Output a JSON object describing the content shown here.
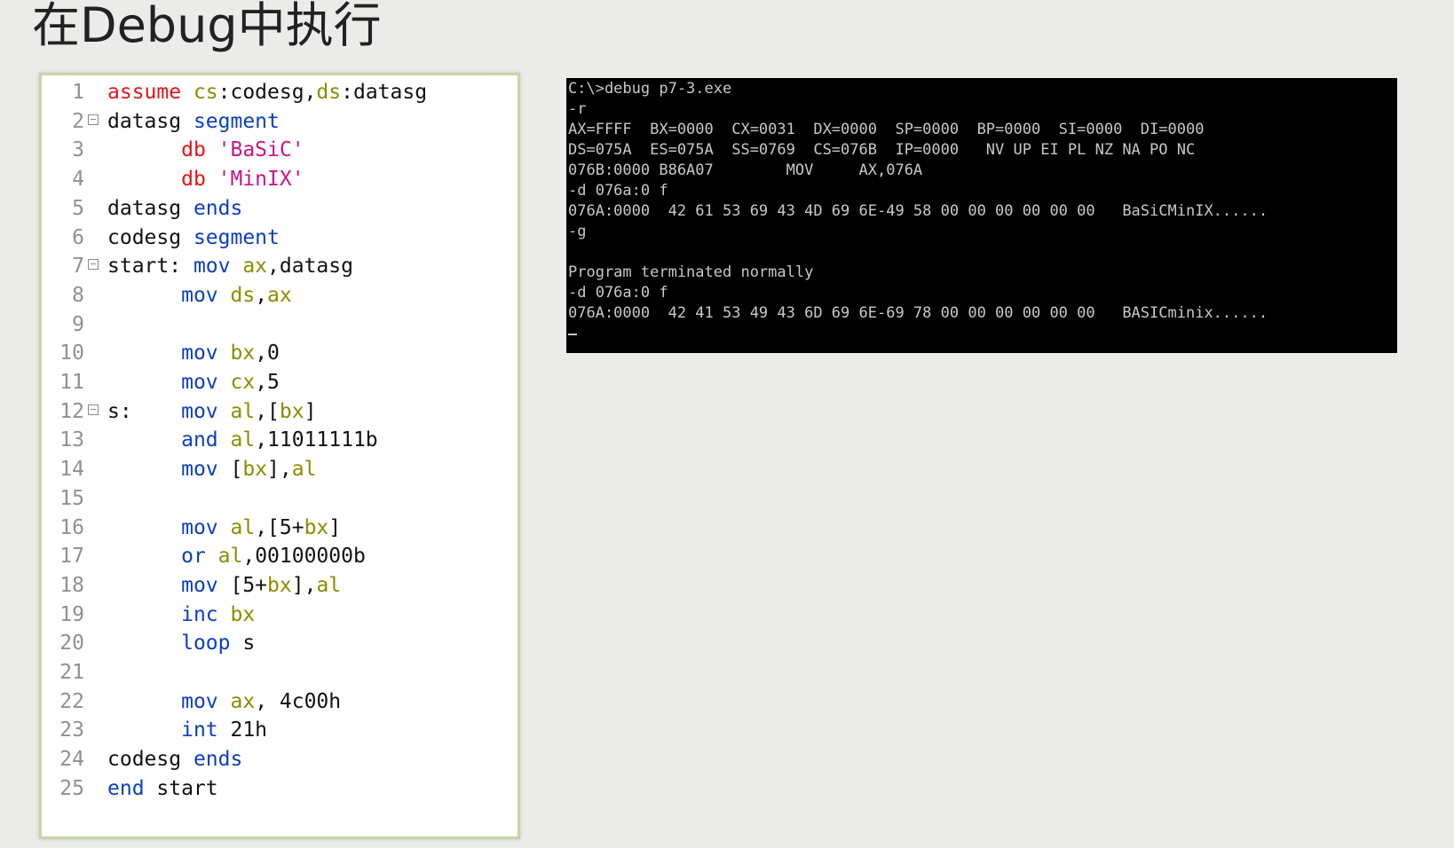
{
  "title": "在Debug中执行",
  "code": {
    "lines": [
      {
        "n": "1",
        "fold": false,
        "tokens": [
          [
            "dir",
            "assume "
          ],
          [
            "reg",
            "cs"
          ],
          [
            "plain",
            ":codesg,"
          ],
          [
            "reg",
            "ds"
          ],
          [
            "plain",
            ":datasg"
          ]
        ]
      },
      {
        "n": "2",
        "fold": true,
        "tokens": [
          [
            "plain",
            "datasg "
          ],
          [
            "kw",
            "segment"
          ]
        ]
      },
      {
        "n": "3",
        "fold": false,
        "tokens": [
          [
            "plain",
            "      "
          ],
          [
            "dir",
            "db "
          ],
          [
            "str",
            "'BaSiC'"
          ]
        ]
      },
      {
        "n": "4",
        "fold": false,
        "tokens": [
          [
            "plain",
            "      "
          ],
          [
            "dir",
            "db "
          ],
          [
            "str",
            "'MinIX'"
          ]
        ]
      },
      {
        "n": "5",
        "fold": false,
        "tokens": [
          [
            "plain",
            "datasg "
          ],
          [
            "kw",
            "ends"
          ]
        ]
      },
      {
        "n": "6",
        "fold": false,
        "tokens": [
          [
            "plain",
            "codesg "
          ],
          [
            "kw",
            "segment"
          ]
        ]
      },
      {
        "n": "7",
        "fold": true,
        "tokens": [
          [
            "plain",
            "start: "
          ],
          [
            "kw",
            "mov "
          ],
          [
            "reg",
            "ax"
          ],
          [
            "plain",
            ",datasg"
          ]
        ]
      },
      {
        "n": "8",
        "fold": false,
        "tokens": [
          [
            "plain",
            "      "
          ],
          [
            "kw",
            "mov "
          ],
          [
            "reg",
            "ds"
          ],
          [
            "plain",
            ","
          ],
          [
            "reg",
            "ax"
          ]
        ]
      },
      {
        "n": "9",
        "fold": false,
        "tokens": []
      },
      {
        "n": "10",
        "fold": false,
        "tokens": [
          [
            "plain",
            "      "
          ],
          [
            "kw",
            "mov "
          ],
          [
            "reg",
            "bx"
          ],
          [
            "plain",
            ",0"
          ]
        ]
      },
      {
        "n": "11",
        "fold": false,
        "tokens": [
          [
            "plain",
            "      "
          ],
          [
            "kw",
            "mov "
          ],
          [
            "reg",
            "cx"
          ],
          [
            "plain",
            ",5"
          ]
        ]
      },
      {
        "n": "12",
        "fold": true,
        "tokens": [
          [
            "plain",
            "s:    "
          ],
          [
            "kw",
            "mov "
          ],
          [
            "reg",
            "al"
          ],
          [
            "plain",
            ",["
          ],
          [
            "reg",
            "bx"
          ],
          [
            "plain",
            "]"
          ]
        ]
      },
      {
        "n": "13",
        "fold": false,
        "tokens": [
          [
            "plain",
            "      "
          ],
          [
            "kw",
            "and "
          ],
          [
            "reg",
            "al"
          ],
          [
            "plain",
            ",11011111b"
          ]
        ]
      },
      {
        "n": "14",
        "fold": false,
        "tokens": [
          [
            "plain",
            "      "
          ],
          [
            "kw",
            "mov "
          ],
          [
            "plain",
            "["
          ],
          [
            "reg",
            "bx"
          ],
          [
            "plain",
            "],"
          ],
          [
            "reg",
            "al"
          ]
        ]
      },
      {
        "n": "15",
        "fold": false,
        "tokens": []
      },
      {
        "n": "16",
        "fold": false,
        "tokens": [
          [
            "plain",
            "      "
          ],
          [
            "kw",
            "mov "
          ],
          [
            "reg",
            "al"
          ],
          [
            "plain",
            ",[5+"
          ],
          [
            "reg",
            "bx"
          ],
          [
            "plain",
            "]"
          ]
        ]
      },
      {
        "n": "17",
        "fold": false,
        "tokens": [
          [
            "plain",
            "      "
          ],
          [
            "kw",
            "or "
          ],
          [
            "reg",
            "al"
          ],
          [
            "plain",
            ",00100000b"
          ]
        ]
      },
      {
        "n": "18",
        "fold": false,
        "tokens": [
          [
            "plain",
            "      "
          ],
          [
            "kw",
            "mov "
          ],
          [
            "plain",
            "[5+"
          ],
          [
            "reg",
            "bx"
          ],
          [
            "plain",
            "],"
          ],
          [
            "reg",
            "al"
          ]
        ]
      },
      {
        "n": "19",
        "fold": false,
        "tokens": [
          [
            "plain",
            "      "
          ],
          [
            "kw",
            "inc "
          ],
          [
            "reg",
            "bx"
          ]
        ]
      },
      {
        "n": "20",
        "fold": false,
        "tokens": [
          [
            "plain",
            "      "
          ],
          [
            "kw",
            "loop "
          ],
          [
            "plain",
            "s"
          ]
        ]
      },
      {
        "n": "21",
        "fold": false,
        "tokens": []
      },
      {
        "n": "22",
        "fold": false,
        "tokens": [
          [
            "plain",
            "      "
          ],
          [
            "kw",
            "mov "
          ],
          [
            "reg",
            "ax"
          ],
          [
            "plain",
            ", 4c00h"
          ]
        ]
      },
      {
        "n": "23",
        "fold": false,
        "tokens": [
          [
            "plain",
            "      "
          ],
          [
            "kw",
            "int "
          ],
          [
            "plain",
            "21h"
          ]
        ]
      },
      {
        "n": "24",
        "fold": false,
        "tokens": [
          [
            "plain",
            "codesg "
          ],
          [
            "kw",
            "ends"
          ]
        ]
      },
      {
        "n": "25",
        "fold": false,
        "tokens": [
          [
            "kw",
            "end "
          ],
          [
            "plain",
            "start"
          ]
        ]
      }
    ]
  },
  "terminal": {
    "lines": [
      "C:\\>debug p7-3.exe",
      "-r",
      "AX=FFFF  BX=0000  CX=0031  DX=0000  SP=0000  BP=0000  SI=0000  DI=0000",
      "DS=075A  ES=075A  SS=0769  CS=076B  IP=0000   NV UP EI PL NZ NA PO NC",
      "076B:0000 B86A07        MOV     AX,076A",
      "-d 076a:0 f",
      "076A:0000  42 61 53 69 43 4D 69 6E-49 58 00 00 00 00 00 00   BaSiCMinIX......",
      "-g",
      "",
      "Program terminated normally",
      "-d 076a:0 f",
      "076A:0000  42 41 53 49 43 6D 69 6E-69 78 00 00 00 00 00 00   BASICminix......"
    ]
  }
}
